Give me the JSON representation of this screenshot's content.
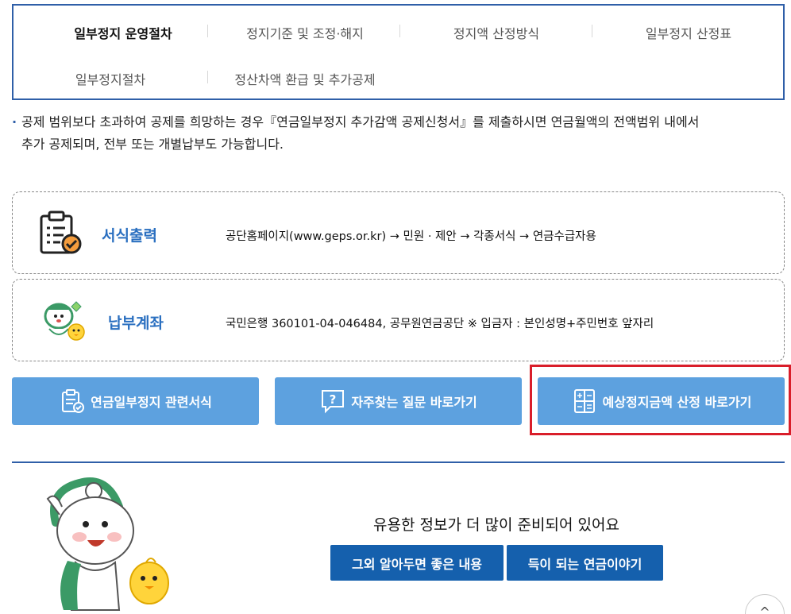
{
  "tabs": [
    {
      "label": "일부정지 운영절차",
      "active": true
    },
    {
      "label": "정지기준 및 조정·해지",
      "active": false
    },
    {
      "label": "정지액 산정방식",
      "active": false
    },
    {
      "label": "일부정지 산정표",
      "active": false
    },
    {
      "label": "일부정지절차",
      "active": false
    },
    {
      "label": "정산차액 환급 및 추가공제",
      "active": false
    }
  ],
  "notice": {
    "line1": "공제 범위보다 초과하여 공제를 희망하는 경우『연금일부정지 추가감액 공제신청서』를 제출하시면 연금월액의 전액범위 내에서",
    "line2": "추가 공제되며, 전부 또는 개별납부도 가능합니다."
  },
  "info_boxes": [
    {
      "title": "서식출력",
      "text": "공단홈페이지(www.geps.or.kr) → 민원 · 제안 → 각종서식 → 연금수급자용",
      "icon": "document-check-icon"
    },
    {
      "title": "납부계좌",
      "text": "국민은행 360101-04-046484, 공무원연금공단 ※ 입금자 : 본인성명+주민번호 앞자리",
      "icon": "mascot-icon"
    }
  ],
  "actions": [
    {
      "label": "연금일부정지 관련서식",
      "icon": "form-document-icon"
    },
    {
      "label": "자주찾는 질문 바로가기",
      "icon": "question-bubble-icon"
    },
    {
      "label": "예상정지금액 산정 바로가기",
      "icon": "calculator-icon"
    }
  ],
  "bottom": {
    "message": "유용한 정보가 더 많이 준비되어 있어요",
    "buttons": [
      "그외 알아두면 좋은 내용",
      "득이 되는 연금이야기"
    ]
  },
  "colors": {
    "primary_blue": "#2f5fa8",
    "button_light_blue": "#5da1df",
    "button_dark_blue": "#1560ad",
    "highlight_red": "#d91e2a",
    "info_title_blue": "#2a6fc0"
  }
}
